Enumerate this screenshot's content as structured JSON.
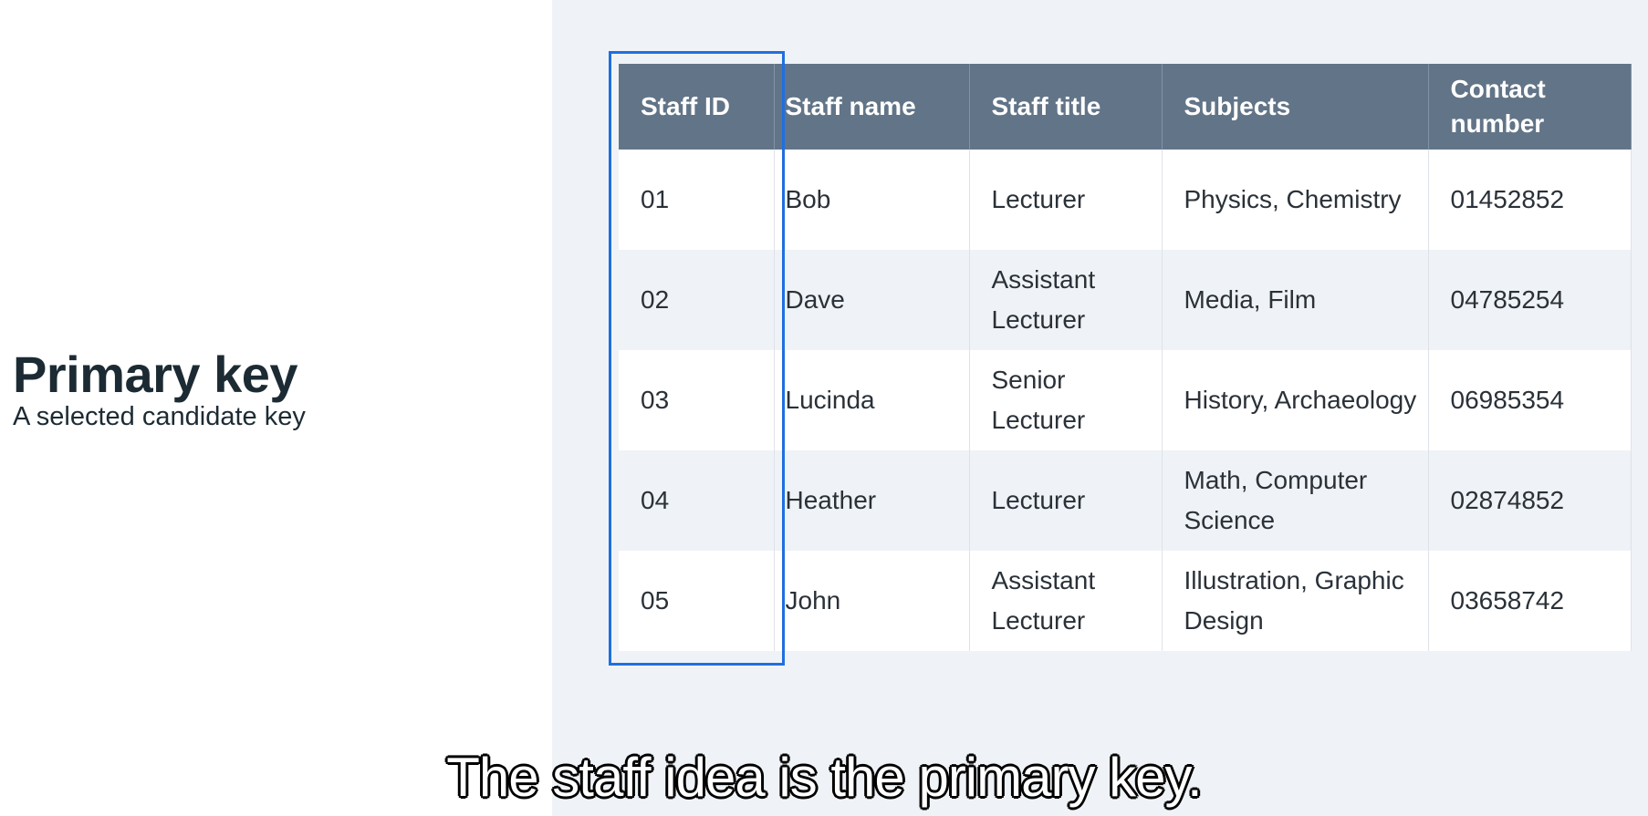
{
  "slide": {
    "title": "Primary key",
    "subtitle": "A selected candidate key"
  },
  "table": {
    "headers": [
      "Staff ID",
      "Staff name",
      "Staff title",
      "Subjects",
      "Contact number"
    ],
    "rows": [
      [
        "01",
        "Bob",
        "Lecturer",
        "Physics, Chemistry",
        "01452852"
      ],
      [
        "02",
        "Dave",
        "Assistant Lecturer",
        "Media, Film",
        "04785254"
      ],
      [
        "03",
        "Lucinda",
        "Senior Lecturer",
        "History, Archaeology",
        "06985354"
      ],
      [
        "04",
        "Heather",
        "Lecturer",
        "Math, Computer Science",
        "02874852"
      ],
      [
        "05",
        "John",
        "Assistant Lecturer",
        "Illustration, Graphic Design",
        "03658742"
      ]
    ],
    "highlighted_column": "Staff ID"
  },
  "caption": "The staff idea is the primary key.",
  "colors": {
    "header_bg": "#627487",
    "highlight_border": "#1f6fe0",
    "panel_bg": "#eff3f7"
  }
}
